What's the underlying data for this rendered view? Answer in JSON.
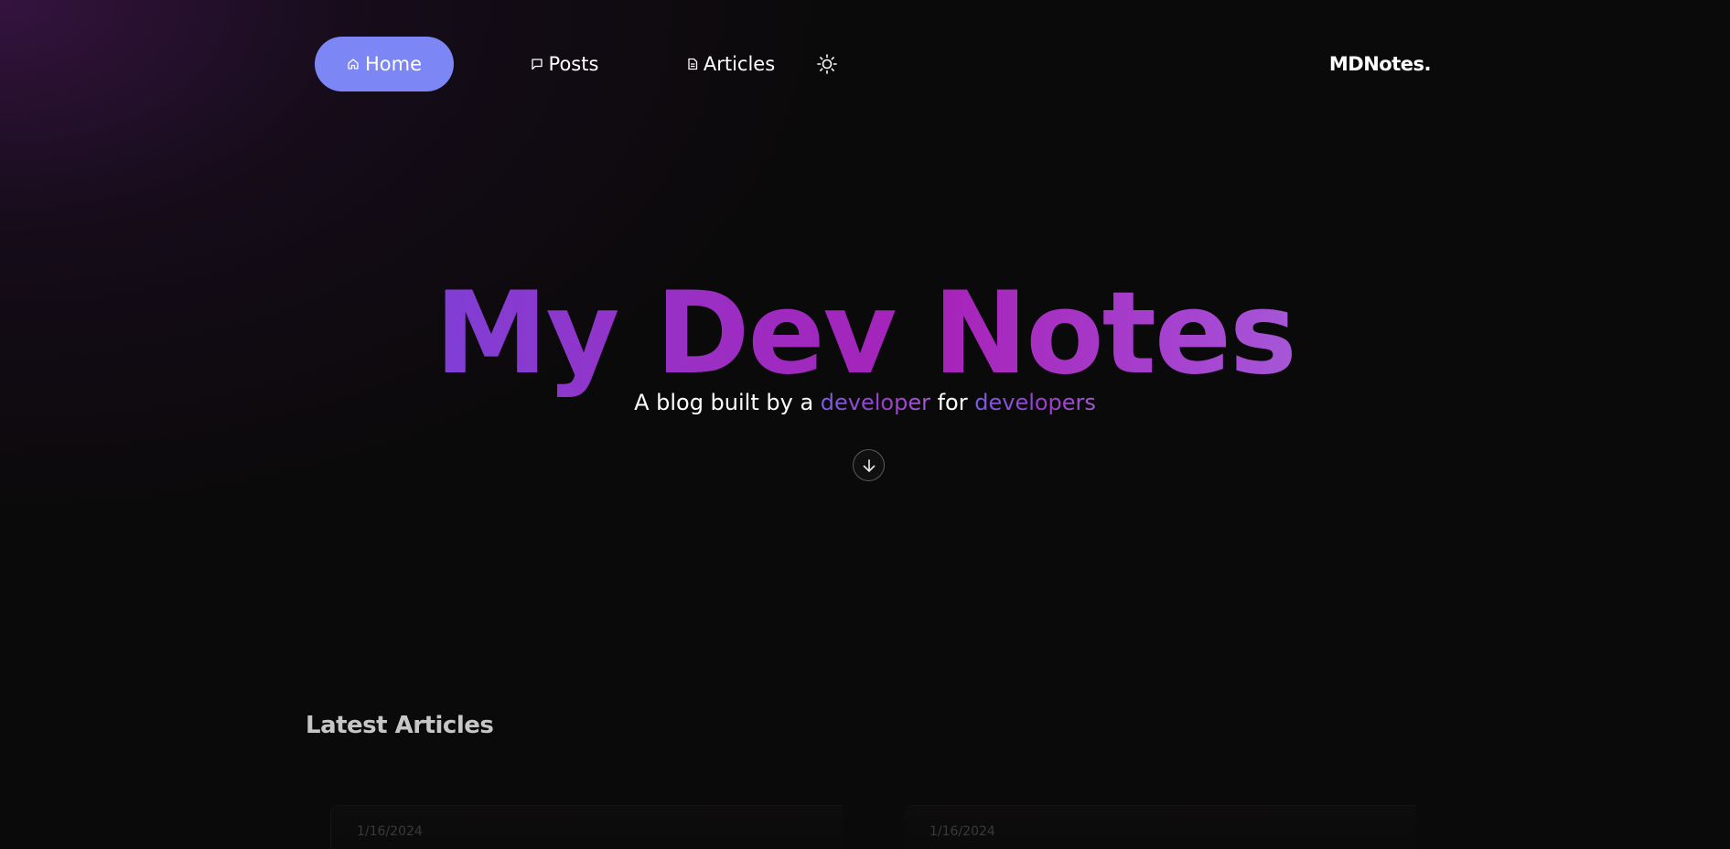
{
  "nav": {
    "items": [
      {
        "label": "Home",
        "icon": "home-icon",
        "active": true
      },
      {
        "label": "Posts",
        "icon": "message-icon",
        "active": false
      },
      {
        "label": "Articles",
        "icon": "document-icon",
        "active": false
      }
    ],
    "theme_toggle_icon": "sun-icon",
    "brand": "MDNotes."
  },
  "hero": {
    "title": "My Dev Notes",
    "subtitle_prefix": "A blog built by a ",
    "subtitle_highlight_1": "developer",
    "subtitle_middle": " for ",
    "subtitle_highlight_2": "developers",
    "scroll_icon": "arrow-down-icon"
  },
  "latest": {
    "title": "Latest Articles",
    "cards": [
      {
        "date": "1/16/2024"
      },
      {
        "date": "1/16/2024"
      }
    ]
  },
  "colors": {
    "background": "#0b0a0a",
    "accent": "#7c87f5",
    "gradient_start": "#5f63ee",
    "gradient_mid": "#a722b8",
    "gradient_end": "#a996f0"
  }
}
